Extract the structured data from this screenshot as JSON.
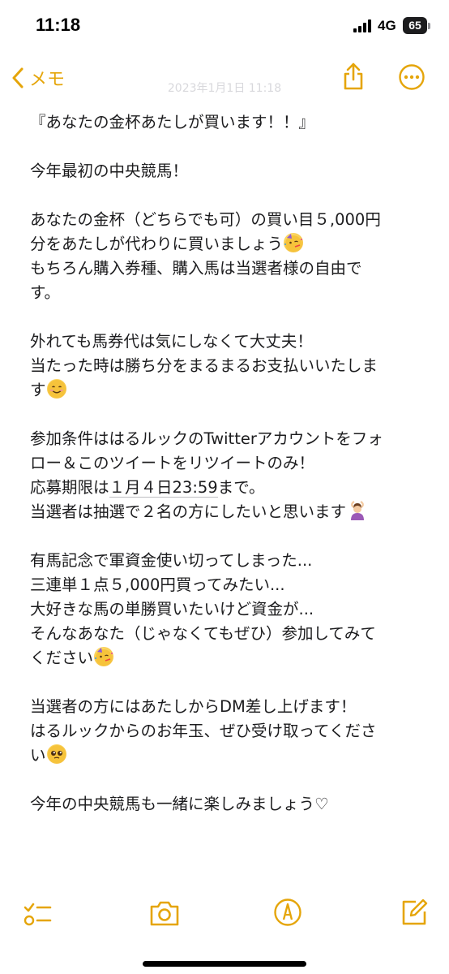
{
  "status_bar": {
    "time": "11:18",
    "network": "4G",
    "battery": "65"
  },
  "nav": {
    "back_label": "メモ",
    "share_icon": "share-icon",
    "more_icon": "ellipsis-circle-icon",
    "accent_color": "#e5a50a"
  },
  "note": {
    "date_faded": "2023年1月1日 11:18",
    "paragraphs": [
      {
        "lines": [
          "『あなたの金杯あたしが買います！！』"
        ]
      },
      {
        "lines": [
          "今年最初の中央競馬！"
        ]
      },
      {
        "lines": [
          "あなたの金杯（どちらでも可）の買い目５,000円",
          "分をあたしが代わりに買いましょう",
          "もちろん購入券種、購入馬は当選者様の自由で",
          "す。"
        ]
      },
      {
        "lines": [
          "外れても馬券代は気にしなくて大丈夫！",
          "当たった時は勝ち分をまるまるお支払いいたしま",
          "す"
        ]
      },
      {
        "lines": [
          "参加条件ははるルックのTwitterアカウントをフォ",
          "ロー＆このツイートをリツイートのみ！",
          "応募期限は",
          "１月４日23:59",
          "まで。",
          "当選者は抽選で２名の方にしたいと思います"
        ]
      },
      {
        "lines": [
          "有馬記念で軍資金使い切ってしまった...",
          "三連単１点５,000円買ってみたい...",
          "大好きな馬の単勝買いたいけど資金が...",
          "そんなあなた（じゃなくてもぜひ）参加してみて",
          "ください"
        ]
      },
      {
        "lines": [
          "当選者の方にはあたしからDM差し上げます！",
          "はるルックからのお年玉、ぜひ受け取ってくださ",
          "い"
        ]
      },
      {
        "lines": [
          "今年の中央競馬も一緒に楽しみましょう♡"
        ]
      }
    ]
  },
  "toolbar": {
    "checklist_icon": "checklist-icon",
    "camera_icon": "camera-icon",
    "markup_icon": "markup-pen-icon",
    "compose_icon": "compose-icon"
  }
}
